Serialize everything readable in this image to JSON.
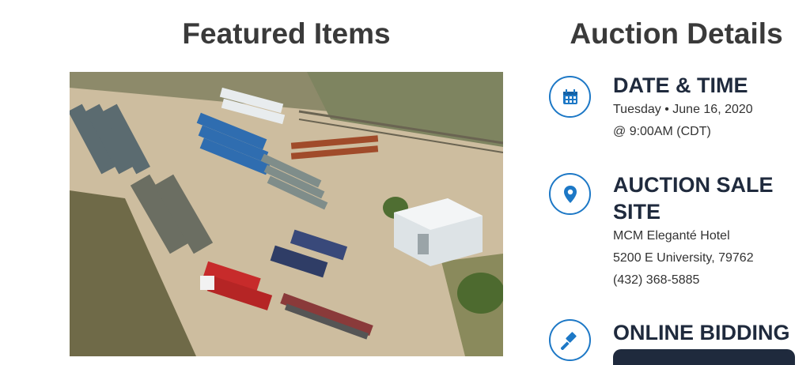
{
  "featured": {
    "title": "Featured Items"
  },
  "details": {
    "title": "Auction Details",
    "date_time": {
      "heading": "DATE & TIME",
      "line1": "Tuesday • June 16, 2020",
      "line2": "@ 9:00AM (CDT)",
      "icon": "calendar-icon"
    },
    "site": {
      "heading_line1": "AUCTION SALE",
      "heading_line2": "SITE",
      "venue": "MCM Eleganté Hotel",
      "address": "5200 E University, 79762",
      "phone": "(432) 368-5885",
      "icon": "map-pin-icon"
    },
    "online": {
      "heading": "ONLINE BIDDING",
      "icon": "gavel-icon"
    }
  },
  "colors": {
    "accent": "#1d78c6",
    "heading": "#1f2a3d"
  }
}
